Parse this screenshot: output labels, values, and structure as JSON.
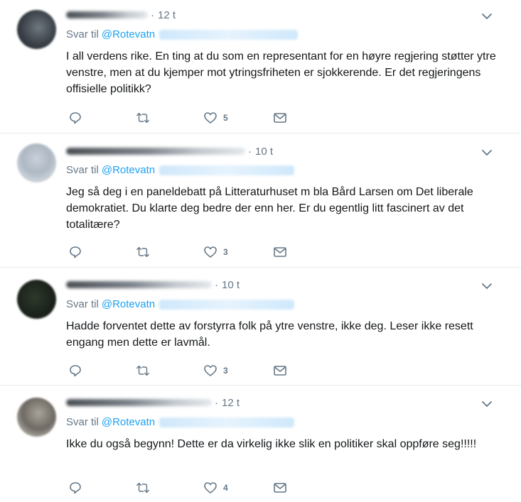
{
  "reply_prefix": "Svar til",
  "tweets": [
    {
      "time": "12 t",
      "mention": "@Rotevatn",
      "text": "I all verdens rike. En ting at du som en representant for en høyre regjering støtter ytre venstre, men at du kjemper mot ytringsfriheten er sjokkerende. Er det regjeringens offisielle politikk?",
      "likes": "5"
    },
    {
      "time": "10 t",
      "mention": "@Rotevatn",
      "text": "Jeg så deg i en paneldebatt på Litteraturhuset m bla Bård Larsen om Det liberale demokratiet. Du klarte deg bedre der enn her. Er du egentlig litt fascinert av det totalitære?",
      "likes": "3"
    },
    {
      "time": "10 t",
      "mention": "@Rotevatn",
      "text": "Hadde forventet dette av forstyrra folk på ytre venstre, ikke deg. Leser ikke resett engang men dette er lavmål.",
      "likes": "3"
    },
    {
      "time": "12 t",
      "mention": "@Rotevatn",
      "text": "Ikke du også begynn! Dette er da virkelig ikke slik en politiker skal oppføre seg!!!!!",
      "likes": "4"
    }
  ],
  "icons": {
    "reply": "reply-icon",
    "retweet": "retweet-icon",
    "like": "heart-icon",
    "message": "envelope-icon",
    "menu": "chevron-down-icon"
  },
  "colors": {
    "link": "#1da1f2",
    "secondary_text": "#657786",
    "divider": "#e6ecf0"
  }
}
